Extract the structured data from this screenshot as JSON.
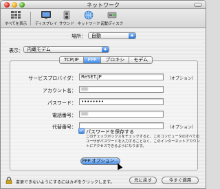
{
  "window": {
    "title": "ネットワーク"
  },
  "toolbar": {
    "items": [
      {
        "label": "すべてを表示",
        "icon": "grid-icon"
      },
      {
        "label": "ディスプレイ",
        "icon": "display-icon"
      },
      {
        "label": "サウンド",
        "icon": "sound-icon"
      },
      {
        "label": "ネットワーク",
        "icon": "network-icon"
      },
      {
        "label": "起動ディスク",
        "icon": "startup-disk-icon"
      }
    ]
  },
  "location": {
    "label": "場所：",
    "value": "自動"
  },
  "show": {
    "label": "表示：",
    "value": "内蔵モデム"
  },
  "tabs": [
    {
      "label": "TCP/IP",
      "active": false
    },
    {
      "label": "PPP",
      "active": true
    },
    {
      "label": "プロキシ",
      "active": false
    },
    {
      "label": "モデム",
      "active": false
    }
  ],
  "ppp": {
    "service_provider_label": "サービスプロバイダ：",
    "service_provider_value": "ReSET.JP",
    "service_provider_option": "（オプション）",
    "account_label": "アカウント名：",
    "password_label": "パスワード：",
    "password_value": "••••••••",
    "phone_label": "電話番号：",
    "alt_number_label": "代替番号：",
    "alt_number_option": "（オプション）",
    "save_password_label": "パスワードを保存する",
    "save_password_checked": true,
    "save_password_note": "このチェックボックスをチェックすると、このコンピュータのすべてのユーザがパスワードを入力することなく、このインターネットアカウントにアクセスできるようになります。",
    "ppp_options_button": "PPP オプション..."
  },
  "footer": {
    "lock_text": "変更できないようにするにはカギをクリックします。",
    "revert_button": "元に戻す",
    "apply_button": "今すぐ適用"
  },
  "colors": {
    "accent": "#3a86e8",
    "close": "#d9281c",
    "minimize": "#e8a50d",
    "zoom": "#4aa326"
  }
}
